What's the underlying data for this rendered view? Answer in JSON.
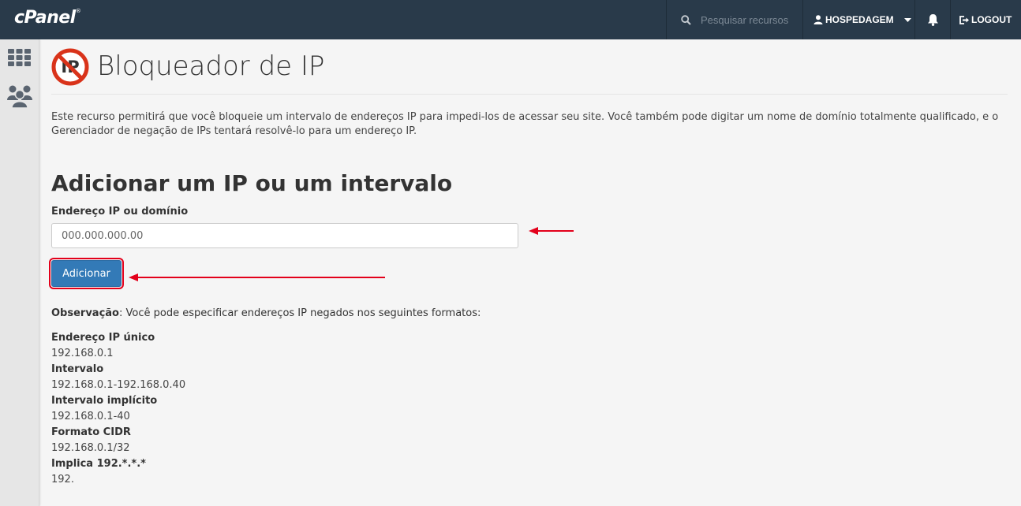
{
  "topbar": {
    "logo": "cPanel",
    "logo_mark": "®",
    "search_placeholder": "Pesquisar recursos",
    "user_label": "HOSPEDAGEM",
    "logout_label": "LOGOUT"
  },
  "page": {
    "title": "Bloqueador de IP",
    "description": "Este recurso permitirá que você bloqueie um intervalo de endereços IP para impedi-los de acessar seu site. Você também pode digitar um nome de domínio totalmente qualificado, e o Gerenciador de negação de IPs tentará resolvê-lo para um endereço IP."
  },
  "form": {
    "section_title": "Adicionar um IP ou um intervalo",
    "field_label": "Endereço IP ou domínio",
    "input_placeholder": "000.000.000.00",
    "input_value": "",
    "submit_label": "Adicionar"
  },
  "note": {
    "label": "Observação",
    "text": ": Você pode especificar endereços IP negados nos seguintes formatos:"
  },
  "formats": [
    {
      "name": "Endereço IP único",
      "value": "192.168.0.1"
    },
    {
      "name": "Intervalo",
      "value": "192.168.0.1-192.168.0.40"
    },
    {
      "name": "Intervalo implícito",
      "value": "192.168.0.1-40"
    },
    {
      "name": "Formato CIDR",
      "value": "192.168.0.1/32"
    },
    {
      "name": "Implica 192.*.*.*",
      "value": "192."
    }
  ],
  "colors": {
    "topbar": "#293a4a",
    "primary_button": "#337ab7",
    "annotation_red": "#e3001b",
    "block_icon_red": "#d9331a"
  }
}
